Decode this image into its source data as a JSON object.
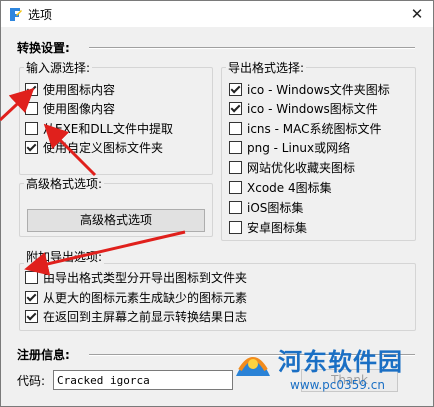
{
  "window": {
    "title": "选项",
    "close_glyph": "✕"
  },
  "conversion": {
    "title": "转换设置:"
  },
  "input_source": {
    "label": "输入源选择:",
    "options": [
      {
        "label": "使用图标内容",
        "checked": true
      },
      {
        "label": "使用图像内容",
        "checked": false
      },
      {
        "label": "从EXE和DLL文件中提取",
        "checked": false
      },
      {
        "label": "使用自定义图标文件夹",
        "checked": true
      }
    ]
  },
  "advanced": {
    "label": "高级格式选项:",
    "button": "高级格式选项"
  },
  "export_format": {
    "label": "导出格式选择:",
    "options": [
      {
        "label": "ico - Windows文件夹图标",
        "checked": true
      },
      {
        "label": "ico - Windows图标文件",
        "checked": true
      },
      {
        "label": "icns - MAC系统图标文件",
        "checked": false
      },
      {
        "label": "png - Linux或网络",
        "checked": false
      },
      {
        "label": "网站优化收藏夹图标",
        "checked": false
      },
      {
        "label": "Xcode 4图标集",
        "checked": false
      },
      {
        "label": "iOS图标集",
        "checked": false
      },
      {
        "label": "安卓图标集",
        "checked": false
      }
    ]
  },
  "additional": {
    "label": "附加导出选项:",
    "options": [
      {
        "label": "由导出格式类型分开导出图标到文件夹",
        "checked": false
      },
      {
        "label": "从更大的图标元素生成缺少的图标元素",
        "checked": true
      },
      {
        "label": "在返回到主屏幕之前显示转换结果日志",
        "checked": true
      }
    ]
  },
  "registration": {
    "title": "注册信息:",
    "code_label": "代码:",
    "code_value": "Cracked igorca",
    "thanks_button": "Thank"
  },
  "watermark": {
    "brand": "河东软件园",
    "url": "www.pc0359.cn"
  },
  "colors": {
    "arrow": "#e0201c",
    "watermark_text": "#1a6fc4"
  }
}
